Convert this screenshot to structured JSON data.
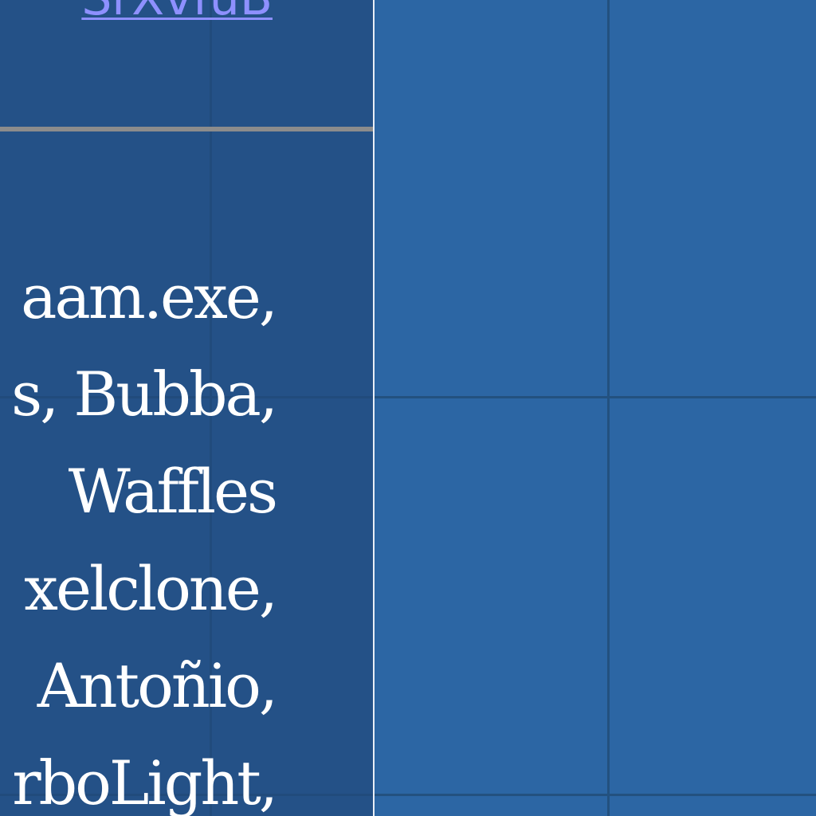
{
  "header": {
    "link_text": "SrXvfuB"
  },
  "credits": {
    "lines": [
      "aam.exe,",
      "s, Bubba,",
      "Waffles",
      "xelclone,",
      "Antoñio,",
      "rboLight,"
    ]
  },
  "colors": {
    "background": "#2c66a4",
    "panel": "#234e80",
    "link": "#8e90ff",
    "divider": "#8c8c8c",
    "text": "#ffffff"
  }
}
